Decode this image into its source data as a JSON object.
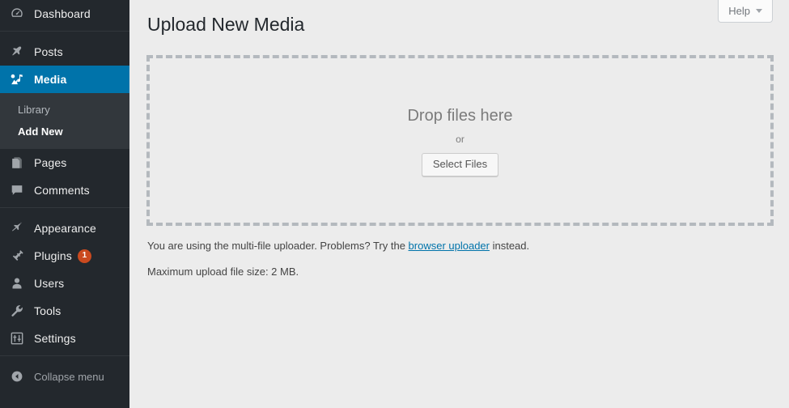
{
  "sidebar": {
    "items": [
      {
        "label": "Dashboard",
        "icon": "dashboard-icon",
        "name": "dashboard",
        "current": false,
        "badge": null
      },
      {
        "label": "Posts",
        "icon": "pin-icon",
        "name": "posts",
        "current": false,
        "badge": null
      },
      {
        "label": "Media",
        "icon": "media-icon",
        "name": "media",
        "current": true,
        "badge": null
      },
      {
        "label": "Pages",
        "icon": "pages-icon",
        "name": "pages",
        "current": false,
        "badge": null
      },
      {
        "label": "Comments",
        "icon": "comment-icon",
        "name": "comments",
        "current": false,
        "badge": null
      },
      {
        "label": "Appearance",
        "icon": "brush-icon",
        "name": "appearance",
        "current": false,
        "badge": null
      },
      {
        "label": "Plugins",
        "icon": "plug-icon",
        "name": "plugins",
        "current": false,
        "badge": "1"
      },
      {
        "label": "Users",
        "icon": "user-icon",
        "name": "users",
        "current": false,
        "badge": null
      },
      {
        "label": "Tools",
        "icon": "wrench-icon",
        "name": "tools",
        "current": false,
        "badge": null
      },
      {
        "label": "Settings",
        "icon": "sliders-icon",
        "name": "settings",
        "current": false,
        "badge": null
      }
    ],
    "media_submenu": [
      {
        "label": "Library",
        "current": false
      },
      {
        "label": "Add New",
        "current": true
      }
    ],
    "collapse": {
      "label": "Collapse menu",
      "icon": "arrow-left-circle-icon"
    },
    "accent_current_bg": "#0073aa",
    "bg": "#23282d",
    "submenu_bg": "#32373c",
    "badge_color": "#ca4a1f"
  },
  "header": {
    "page_title": "Upload New Media",
    "help_tab": {
      "label": "Help",
      "icon": "chevron-down-icon"
    }
  },
  "uploader": {
    "drop_title": "Drop files here",
    "or_text": "or",
    "select_files_label": "Select Files",
    "border_color": "#b4b9be"
  },
  "notes": {
    "uploader_prefix": "You are using the multi-file uploader. Problems? Try the ",
    "uploader_link": "browser uploader",
    "uploader_suffix": " instead.",
    "max_size": "Maximum upload file size: 2 MB.",
    "link_color": "#0073aa"
  }
}
